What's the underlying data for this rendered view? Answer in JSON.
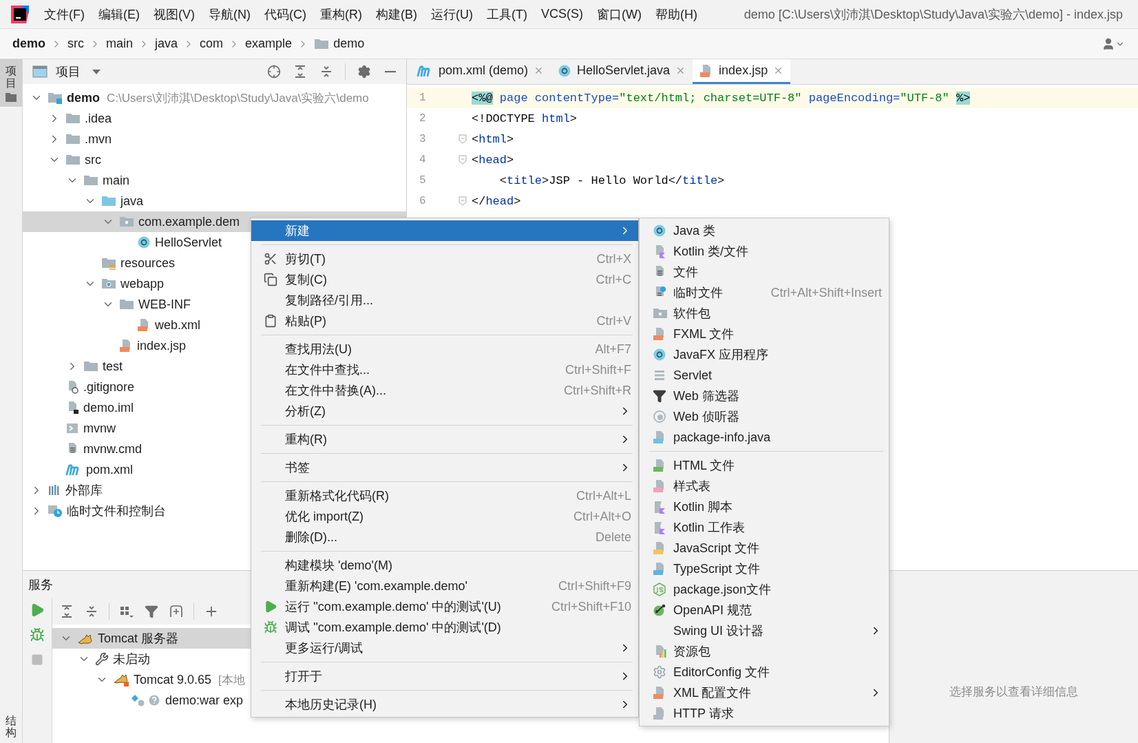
{
  "menubar": {
    "items": [
      "文件(F)",
      "编辑(E)",
      "视图(V)",
      "导航(N)",
      "代码(C)",
      "重构(R)",
      "构建(B)",
      "运行(U)",
      "工具(T)",
      "VCS(S)",
      "窗口(W)",
      "帮助(H)"
    ],
    "title": "demo [C:\\Users\\刘沛淇\\Desktop\\Study\\Java\\实验六\\demo] - index.jsp"
  },
  "breadcrumb": [
    {
      "label": "demo",
      "kind": "project"
    },
    {
      "label": "src",
      "kind": "dir"
    },
    {
      "label": "main",
      "kind": "dir"
    },
    {
      "label": "java",
      "kind": "dir"
    },
    {
      "label": "com",
      "kind": "dir"
    },
    {
      "label": "example",
      "kind": "dir"
    },
    {
      "label": "demo",
      "kind": "package"
    }
  ],
  "side_tabs": [
    {
      "label": "项目",
      "selected": true
    },
    {
      "label": "结构",
      "selected": false
    }
  ],
  "project_panel": {
    "title": "项目",
    "tree": [
      {
        "label": "demo",
        "kind": "module",
        "hint": "C:\\Users\\刘沛淇\\Desktop\\Study\\Java\\实验六\\demo",
        "expanded": true,
        "selected": false,
        "children": [
          {
            "label": ".idea",
            "kind": "folder",
            "expanded": false,
            "selected": false
          },
          {
            "label": ".mvn",
            "kind": "folder",
            "expanded": false,
            "selected": false
          },
          {
            "label": "src",
            "kind": "folder",
            "expanded": true,
            "selected": false,
            "children": [
              {
                "label": "main",
                "kind": "folder",
                "expanded": true,
                "selected": false,
                "children": [
                  {
                    "label": "java",
                    "kind": "source-folder",
                    "expanded": true,
                    "selected": false,
                    "children": [
                      {
                        "label": "com.example.dem",
                        "kind": "package",
                        "expanded": true,
                        "selected": true,
                        "children": [
                          {
                            "label": "HelloServlet",
                            "kind": "class",
                            "selected": false
                          }
                        ]
                      }
                    ]
                  },
                  {
                    "label": "resources",
                    "kind": "resources",
                    "selected": false
                  },
                  {
                    "label": "webapp",
                    "kind": "web",
                    "expanded": true,
                    "selected": false,
                    "children": [
                      {
                        "label": "WEB-INF",
                        "kind": "folder",
                        "expanded": true,
                        "selected": false,
                        "children": [
                          {
                            "label": "web.xml",
                            "kind": "xml",
                            "selected": false
                          }
                        ]
                      },
                      {
                        "label": "index.jsp",
                        "kind": "jsp",
                        "selected": false
                      }
                    ]
                  }
                ]
              },
              {
                "label": "test",
                "kind": "folder",
                "expanded": false,
                "selected": false
              }
            ]
          },
          {
            "label": ".gitignore",
            "kind": "gitignore",
            "selected": false
          },
          {
            "label": "demo.iml",
            "kind": "iml",
            "selected": false
          },
          {
            "label": "mvnw",
            "kind": "shell",
            "selected": false
          },
          {
            "label": "mvnw.cmd",
            "kind": "cmd",
            "selected": false
          },
          {
            "label": "pom.xml",
            "kind": "maven",
            "selected": false
          }
        ]
      },
      {
        "label": "外部库",
        "kind": "libraries",
        "expanded": false,
        "selected": false
      },
      {
        "label": "临时文件和控制台",
        "kind": "scratches",
        "expanded": false,
        "selected": false
      }
    ]
  },
  "editor": {
    "tabs": [
      {
        "label": "pom.xml (demo)",
        "kind": "maven",
        "selected": false
      },
      {
        "label": "HelloServlet.java",
        "kind": "class",
        "selected": false
      },
      {
        "label": "index.jsp",
        "kind": "jsp",
        "selected": true
      }
    ],
    "lines": [
      {
        "number": "1",
        "current": true,
        "tokens": [
          {
            "kind": "directive",
            "text": "<%@"
          },
          {
            "kind": "attr",
            "text": " page contentType="
          },
          {
            "kind": "string",
            "text": "\"text/html; charset=UTF-8\""
          },
          {
            "kind": "attr",
            "text": " pageEncoding="
          },
          {
            "kind": "string",
            "text": "\"UTF-8\" "
          },
          {
            "kind": "directive",
            "text": "%>"
          }
        ]
      },
      {
        "number": "2",
        "tokens": [
          {
            "kind": "plain",
            "text": "<!DOCTYPE "
          },
          {
            "kind": "tag",
            "text": "html"
          },
          {
            "kind": "plain",
            "text": ">"
          }
        ]
      },
      {
        "number": "3",
        "fold": true,
        "tokens": [
          {
            "kind": "plain",
            "text": "<"
          },
          {
            "kind": "tag",
            "text": "html"
          },
          {
            "kind": "plain",
            "text": ">"
          }
        ]
      },
      {
        "number": "4",
        "fold": true,
        "tokens": [
          {
            "kind": "plain",
            "text": "<"
          },
          {
            "kind": "tag",
            "text": "head"
          },
          {
            "kind": "plain",
            "text": ">"
          }
        ]
      },
      {
        "number": "5",
        "tokens": [
          {
            "kind": "plain",
            "text": "    <"
          },
          {
            "kind": "tag",
            "text": "title"
          },
          {
            "kind": "plain",
            "text": ">JSP - Hello World</"
          },
          {
            "kind": "tag",
            "text": "title"
          },
          {
            "kind": "plain",
            "text": ">"
          }
        ]
      },
      {
        "number": "6",
        "fold": true,
        "tokens": [
          {
            "kind": "plain",
            "text": "</"
          },
          {
            "kind": "tag",
            "text": "head"
          },
          {
            "kind": "plain",
            "text": ">"
          }
        ]
      }
    ]
  },
  "services": {
    "title": "服务",
    "tree": [
      {
        "label": "Tomcat 服务器",
        "kind": "tomcat",
        "expanded": true,
        "selected": true,
        "children": [
          {
            "label": "未启动",
            "kind": "wrench",
            "expanded": true,
            "selected": false,
            "children": [
              {
                "label": "Tomcat 9.0.65",
                "kind": "tomcat-server",
                "hint": "[本地",
                "expanded": true,
                "selected": false,
                "children": [
                  {
                    "label": "demo:war exp",
                    "kind": "artifact",
                    "selected": false
                  }
                ]
              }
            ]
          }
        ]
      }
    ],
    "message": "选择服务以查看详细信息"
  },
  "context_menu": {
    "groups": [
      {
        "items": [
          {
            "label": "新建",
            "kind": "plain",
            "submenu": true,
            "selected": true
          }
        ]
      },
      {
        "items": [
          {
            "label": "剪切(T)",
            "kind": "cut",
            "shortcut": "Ctrl+X",
            "selected": false
          },
          {
            "label": "复制(C)",
            "kind": "copy",
            "shortcut": "Ctrl+C",
            "selected": false
          },
          {
            "label": "复制路径/引用...",
            "kind": "plain",
            "selected": false
          },
          {
            "label": "粘贴(P)",
            "kind": "paste",
            "shortcut": "Ctrl+V",
            "selected": false
          }
        ]
      },
      {
        "items": [
          {
            "label": "查找用法(U)",
            "kind": "plain",
            "shortcut": "Alt+F7",
            "selected": false
          },
          {
            "label": "在文件中查找...",
            "kind": "plain",
            "shortcut": "Ctrl+Shift+F",
            "selected": false
          },
          {
            "label": "在文件中替换(A)...",
            "kind": "plain",
            "shortcut": "Ctrl+Shift+R",
            "selected": false
          },
          {
            "label": "分析(Z)",
            "kind": "plain",
            "submenu": true,
            "selected": false
          }
        ]
      },
      {
        "items": [
          {
            "label": "重构(R)",
            "kind": "plain",
            "submenu": true,
            "selected": false
          }
        ]
      },
      {
        "items": [
          {
            "label": "书签",
            "kind": "plain",
            "submenu": true,
            "selected": false
          }
        ]
      },
      {
        "items": [
          {
            "label": "重新格式化代码(R)",
            "kind": "plain",
            "shortcut": "Ctrl+Alt+L",
            "selected": false
          },
          {
            "label": "优化 import(Z)",
            "kind": "plain",
            "shortcut": "Ctrl+Alt+O",
            "selected": false
          },
          {
            "label": "删除(D)...",
            "kind": "plain",
            "shortcut": "Delete",
            "selected": false
          }
        ]
      },
      {
        "items": [
          {
            "label": "构建模块 'demo'(M)",
            "kind": "plain",
            "selected": false
          },
          {
            "label": "重新构建(E) 'com.example.demo'",
            "kind": "plain",
            "shortcut": "Ctrl+Shift+F9",
            "selected": false
          },
          {
            "label": "运行 ''com.example.demo' 中的测试'(U)",
            "kind": "run",
            "shortcut": "Ctrl+Shift+F10",
            "selected": false
          },
          {
            "label": "调试 ''com.example.demo' 中的测试'(D)",
            "kind": "debug",
            "selected": false
          },
          {
            "label": "更多运行/调试",
            "kind": "plain",
            "submenu": true,
            "selected": false
          }
        ]
      },
      {
        "items": [
          {
            "label": "打开于",
            "kind": "plain",
            "submenu": true,
            "selected": false
          }
        ]
      },
      {
        "items": [
          {
            "label": "本地历史记录(H)",
            "kind": "plain",
            "submenu": true,
            "selected": false
          }
        ]
      }
    ]
  },
  "submenu": {
    "groups": [
      {
        "items": [
          {
            "label": "Java 类",
            "kind": "class",
            "selected": false
          },
          {
            "label": "Kotlin 类/文件",
            "kind": "kotlin",
            "selected": false
          },
          {
            "label": "文件",
            "kind": "file",
            "selected": false
          },
          {
            "label": "临时文件",
            "kind": "scratch",
            "shortcut": "Ctrl+Alt+Shift+Insert",
            "selected": false
          },
          {
            "label": "软件包",
            "kind": "package",
            "selected": false
          },
          {
            "label": "FXML 文件",
            "kind": "xml",
            "selected": false
          },
          {
            "label": "JavaFX 应用程序",
            "kind": "class",
            "selected": false
          },
          {
            "label": "Servlet",
            "kind": "servlet",
            "selected": false
          },
          {
            "label": "Web 筛选器",
            "kind": "filter",
            "selected": false
          },
          {
            "label": "Web 侦听器",
            "kind": "listener",
            "selected": false
          },
          {
            "label": "package-info.java",
            "kind": "java-file",
            "selected": false
          }
        ]
      },
      {
        "items": [
          {
            "label": "HTML 文件",
            "kind": "html",
            "selected": false
          },
          {
            "label": "样式表",
            "kind": "css",
            "selected": false
          },
          {
            "label": "Kotlin 脚本",
            "kind": "kotlin-script",
            "selected": false
          },
          {
            "label": "Kotlin 工作表",
            "kind": "kotlin-script",
            "selected": false
          },
          {
            "label": "JavaScript 文件",
            "kind": "js",
            "selected": false
          },
          {
            "label": "TypeScript 文件",
            "kind": "ts",
            "selected": false
          },
          {
            "label": "package.json文件",
            "kind": "nodejs",
            "selected": false
          },
          {
            "label": "OpenAPI 规范",
            "kind": "openapi",
            "selected": false
          },
          {
            "label": "Swing UI 设计器",
            "kind": "plain",
            "submenu": true,
            "selected": false
          },
          {
            "label": "资源包",
            "kind": "bundle",
            "selected": false
          },
          {
            "label": "EditorConfig 文件",
            "kind": "editorconfig",
            "selected": false
          },
          {
            "label": "XML 配置文件",
            "kind": "xml",
            "submenu": true,
            "selected": false
          },
          {
            "label": "HTTP 请求",
            "kind": "http",
            "selected": false
          }
        ]
      }
    ]
  }
}
